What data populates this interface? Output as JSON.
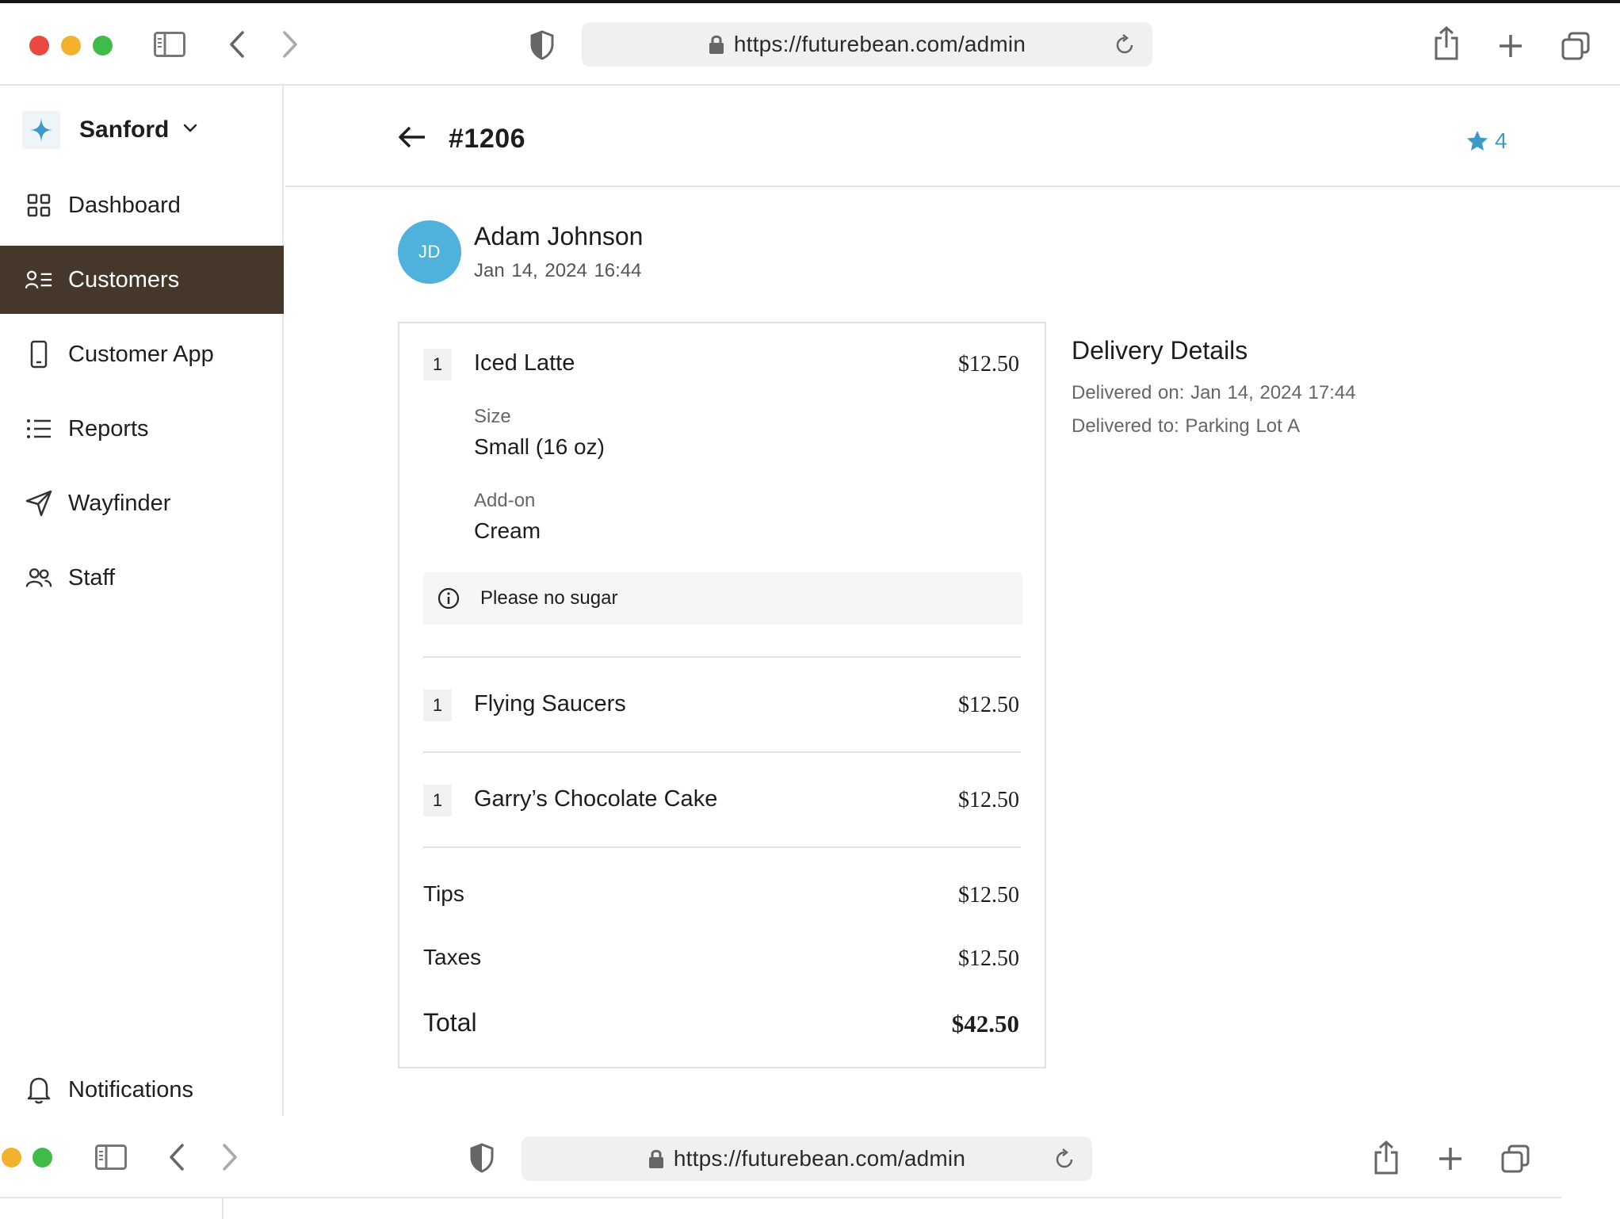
{
  "browser": {
    "url": "https://futurebean.com/admin",
    "traffic_light_colors": [
      "#e9493f",
      "#f2b22d",
      "#3fbb48"
    ]
  },
  "sidebar": {
    "workspace": "Sanford",
    "items": [
      {
        "label": "Dashboard",
        "icon": "grid-icon",
        "active": false
      },
      {
        "label": "Customers",
        "icon": "customers-list-icon",
        "active": true
      },
      {
        "label": "Customer App",
        "icon": "phone-icon",
        "active": false
      },
      {
        "label": "Reports",
        "icon": "list-icon",
        "active": false
      },
      {
        "label": "Wayfinder",
        "icon": "send-arrow-icon",
        "active": false
      },
      {
        "label": "Staff",
        "icon": "users-icon",
        "active": false
      }
    ],
    "notifications_label": "Notifications",
    "active_color": "#46372b"
  },
  "order": {
    "number": "#1206",
    "rating": "4",
    "customer": {
      "initials": "JD",
      "name": "Adam Johnson",
      "datetime": "Jan 14, 2024  16:44"
    },
    "items": [
      {
        "qty": "1",
        "name": "Iced Latte",
        "price": "$12.50",
        "options": [
          {
            "label": "Size",
            "value": "Small (16 oz)"
          },
          {
            "label": "Add-on",
            "value": "Cream"
          }
        ],
        "note": "Please no sugar"
      },
      {
        "qty": "1",
        "name": "Flying Saucers",
        "price": "$12.50"
      },
      {
        "qty": "1",
        "name": "Garry’s Chocolate Cake",
        "price": "$12.50"
      }
    ],
    "summary": {
      "tips_label": "Tips",
      "tips": "$12.50",
      "taxes_label": "Taxes",
      "taxes": "$12.50",
      "total_label": "Total",
      "total": "$42.50"
    }
  },
  "delivery": {
    "title": "Delivery Details",
    "delivered_on": "Delivered on: Jan 14, 2024  17:44",
    "delivered_to": "Delivered to: Parking Lot A"
  },
  "accent_color": "#4fb2dc"
}
